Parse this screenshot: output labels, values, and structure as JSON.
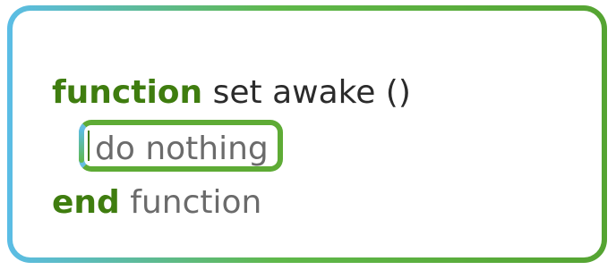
{
  "code": {
    "line1": {
      "keyword": "function",
      "text": "set awake ()"
    },
    "line2": {
      "statement": "do nothing"
    },
    "line3": {
      "keyword": "end",
      "text": "function"
    }
  },
  "colors": {
    "keyword": "#3f7d0f",
    "frame_left": "#5bbde6",
    "frame_right": "#55a432"
  }
}
